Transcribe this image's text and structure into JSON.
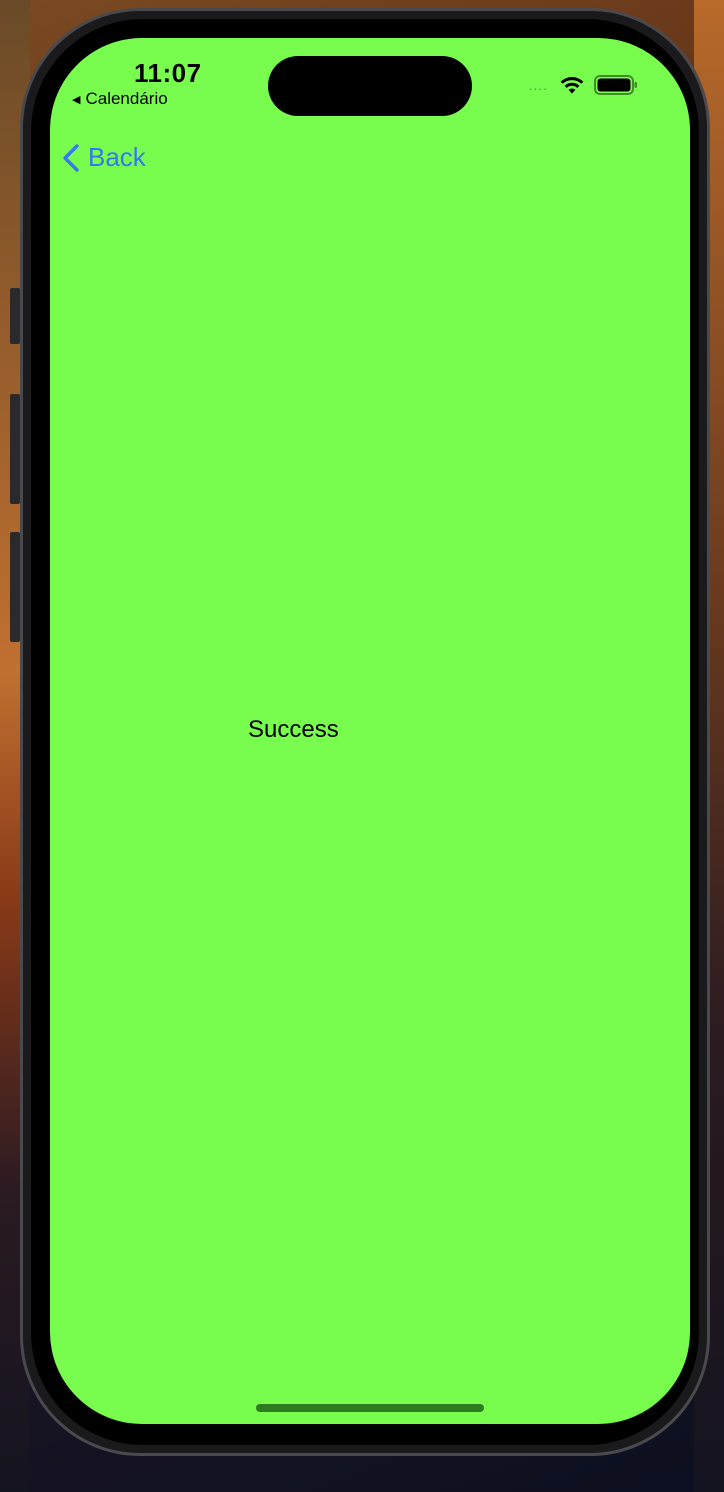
{
  "status_bar": {
    "time": "11:07",
    "back_app_label": "Calendário",
    "back_app_icon": "triangle-left-icon",
    "signal_dots": "....",
    "wifi_icon": "wifi-icon",
    "battery_icon": "battery-icon"
  },
  "nav": {
    "back_label": "Back",
    "back_icon": "chevron-left-icon"
  },
  "content": {
    "message": "Success"
  },
  "colors": {
    "screen_background": "#78fd4f",
    "accent": "#3478f6"
  }
}
